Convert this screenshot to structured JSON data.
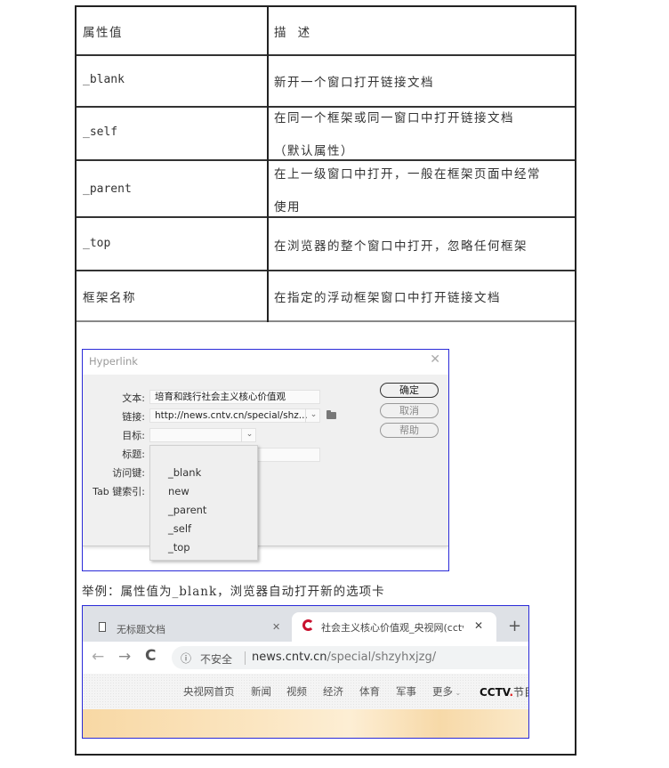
{
  "table": {
    "header": {
      "col1": "属性值",
      "col2": "描  述"
    },
    "rows": [
      {
        "value": "_blank",
        "desc": [
          "新开一个窗口打开链接文档"
        ]
      },
      {
        "value": "_self",
        "desc": [
          "在同一个框架或同一窗口中打开链接文档",
          "（默认属性）"
        ]
      },
      {
        "value": "_parent",
        "desc": [
          "在上一级窗口中打开，一般在框架页面中经常",
          "使用"
        ]
      },
      {
        "value": "_top",
        "desc": [
          "在浏览器的整个窗口中打开，忽略任何框架"
        ]
      },
      {
        "value": "框架名称",
        "desc": [
          "在指定的浮动框架窗口中打开链接文档"
        ]
      }
    ]
  },
  "dialog": {
    "title": "Hyperlink",
    "close_glyph": "✕",
    "labels": {
      "text": "文本:",
      "link": "链接:",
      "target": "目标:",
      "title": "标题:",
      "access_key": "访问键:",
      "tab_index": "Tab 键索引:"
    },
    "fields": {
      "text_value": "培育和践行社会主义核心价值观",
      "link_value": "http://news.cntv.cn/special/shz...",
      "target_value": "",
      "title_value": ""
    },
    "buttons": {
      "ok": "确定",
      "cancel": "取消",
      "help": "帮助"
    },
    "target_options": [
      "_blank",
      "new",
      "_parent",
      "_self",
      "_top"
    ]
  },
  "caption": "举例：属性值为_blank，浏览器自动打开新的选项卡",
  "browser": {
    "tabs": [
      {
        "title": "无标题文档",
        "active": false
      },
      {
        "title": "社会主义核心价值观_央视网(cctv",
        "active": true
      }
    ],
    "new_tab_glyph": "+",
    "close_glyph": "✕",
    "security_label": "不安全",
    "url_host": "news.cntv.cn",
    "url_path": "/special/shzyhxjzg/",
    "site_nav": [
      "央视网首页",
      "新闻",
      "视频",
      "经济",
      "体育",
      "军事",
      "更多"
    ],
    "site_logo": "CCTV",
    "site_logo_dot": ".",
    "site_logo_tail": "节目"
  }
}
